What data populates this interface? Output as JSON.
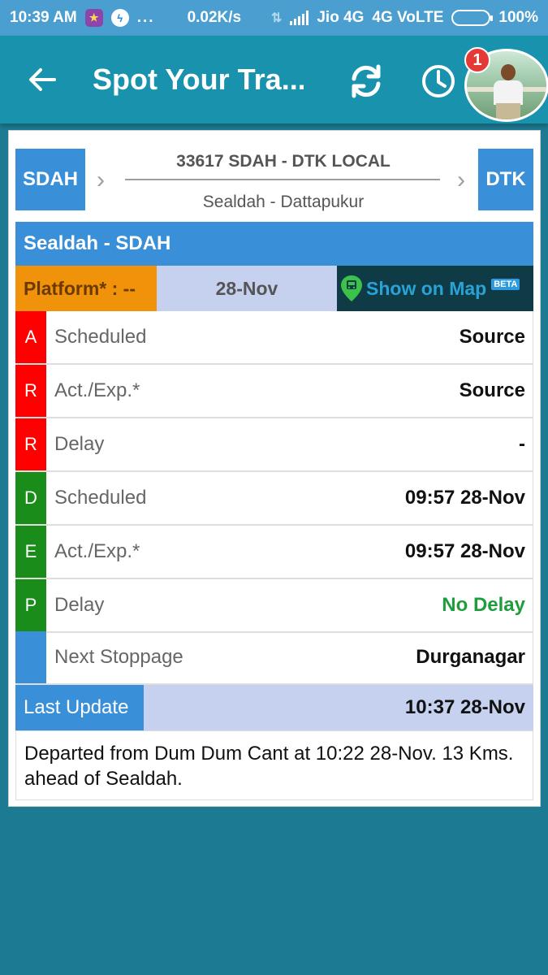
{
  "status_bar": {
    "time": "10:39 AM",
    "dots": "...",
    "speed": "0.02K/s",
    "carrier": "Jio 4G",
    "network": "4G VoLTE",
    "battery": "100%",
    "icons": [
      "starmaker-icon",
      "messenger-icon",
      "data-arrows-icon",
      "signal-icon",
      "battery-icon"
    ]
  },
  "toolbar": {
    "title": "Spot Your Tra...",
    "notification_count": "1",
    "icons": [
      "back-arrow-icon",
      "refresh-icon",
      "clock-icon"
    ]
  },
  "route": {
    "from_code": "SDAH",
    "to_code": "DTK",
    "train_name": "33617 SDAH - DTK LOCAL",
    "route_name": "Sealdah - Dattapukur"
  },
  "station": {
    "title": "Sealdah - SDAH",
    "platform": "Platform* : --",
    "date": "28-Nov",
    "map_label": "Show on Map",
    "map_badge": "BETA"
  },
  "arrival": {
    "letters": [
      "A",
      "R",
      "R"
    ],
    "rows": [
      {
        "label": "Scheduled",
        "value": "Source"
      },
      {
        "label": "Act./Exp.*",
        "value": "Source"
      },
      {
        "label": "Delay",
        "value": "-"
      }
    ]
  },
  "departure": {
    "letters": [
      "D",
      "E",
      "P"
    ],
    "rows": [
      {
        "label": "Scheduled",
        "value": "09:57 28-Nov"
      },
      {
        "label": "Act./Exp.*",
        "value": "09:57 28-Nov"
      },
      {
        "label": "Delay",
        "value": "No Delay"
      }
    ]
  },
  "next_stoppage": {
    "label": "Next Stoppage",
    "value": "Durganagar"
  },
  "last_update": {
    "label": "Last Update",
    "value": "10:37 28-Nov"
  },
  "message": "Departed from Dum Dum Cant at 10:22 28-Nov. 13 Kms. ahead of Sealdah.",
  "colors": {
    "toolbar": "#1992ad",
    "background": "#1c7b93",
    "station_blue": "#3a8fd9",
    "arrival_red": "#ff0000",
    "departure_green": "#1a8c1a",
    "platform_orange": "#f0920a",
    "no_delay_green": "#1f9d3e"
  }
}
